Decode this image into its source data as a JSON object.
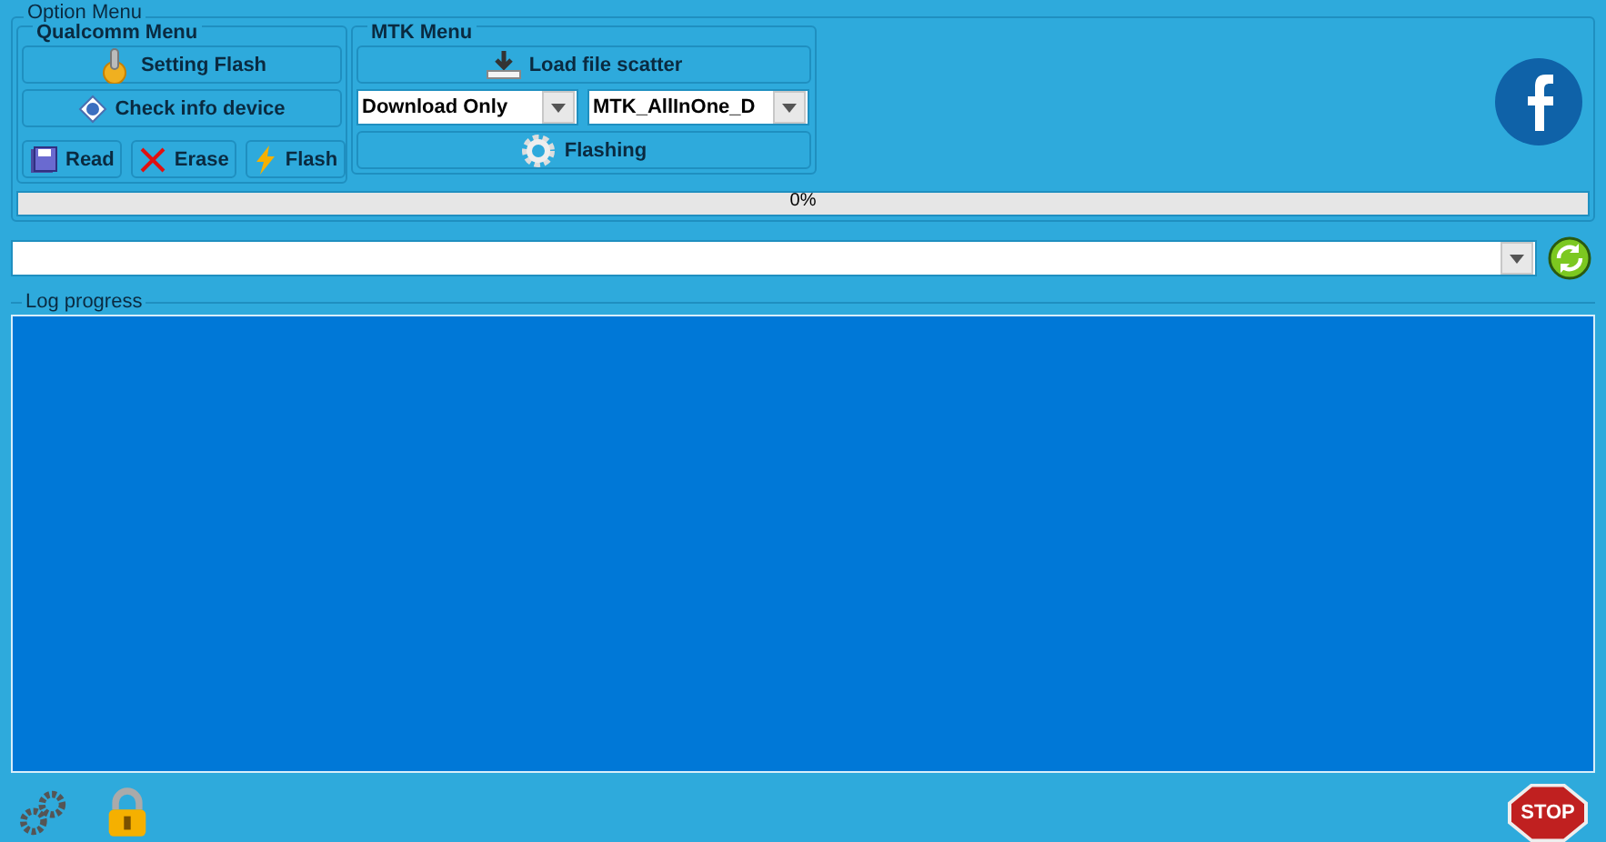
{
  "option_menu": {
    "title": "Option Menu"
  },
  "qualcomm_menu": {
    "title": "Qualcomm Menu",
    "buttons": [
      {
        "kind": "setting",
        "label": "Setting Flash"
      },
      {
        "kind": "info",
        "label": "Check info device"
      }
    ],
    "small_buttons": [
      {
        "kind": "read",
        "label": "Read"
      },
      {
        "kind": "erase",
        "label": "Erase"
      },
      {
        "kind": "flash",
        "label": "Flash"
      }
    ]
  },
  "mtk_menu": {
    "title": "MTK Menu",
    "load_button": "Load file scatter",
    "mode_select": {
      "value": "Download Only"
    },
    "da_select": {
      "value": "MTK_AllInOne_D"
    },
    "flashing_button": "Flashing"
  },
  "progress": {
    "level": 0,
    "reading": "0%"
  },
  "log": {
    "title": "Log progress"
  },
  "stop_button": "STOP"
}
